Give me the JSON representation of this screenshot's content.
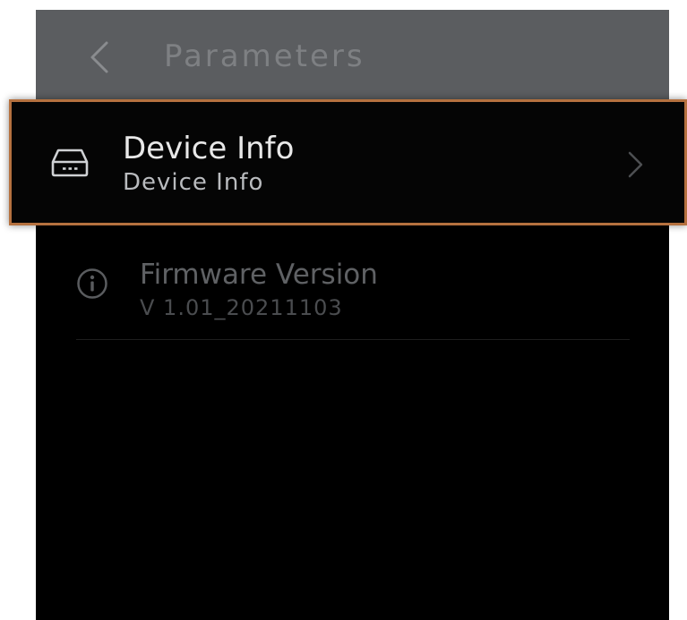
{
  "header": {
    "back_icon": "chevron-left-icon",
    "title": "Parameters"
  },
  "items": [
    {
      "icon": "device-icon",
      "title": "Device Info",
      "subtitle": "Device Info",
      "selected": true,
      "trailing_icon": "chevron-right-icon"
    },
    {
      "icon": "info-circle-icon",
      "title": "Firmware Version",
      "value": "V 1.01_20211103"
    }
  ],
  "colors": {
    "header_bg": "#5b5d60",
    "screen_bg": "#000000",
    "selection_border": "#b5713f",
    "primary_text": "#e8e8e8",
    "dim_text": "#5f6164"
  }
}
